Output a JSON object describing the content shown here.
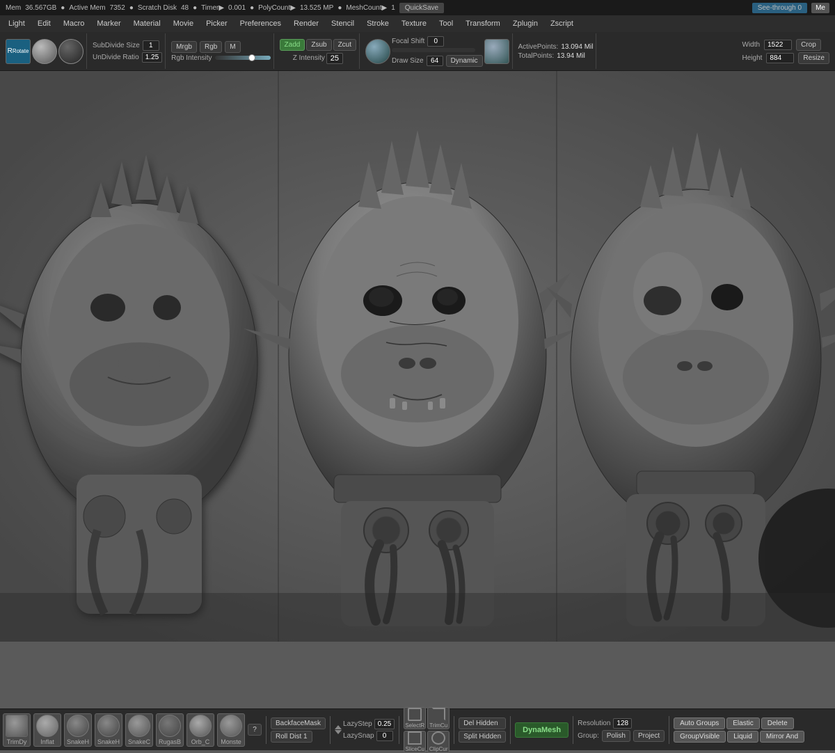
{
  "statusBar": {
    "memory": "36.567GB",
    "activeMem": "7352",
    "scratchDisk": "48",
    "timer": "0.001",
    "polyCount": "13.525 MP",
    "meshCount": "1",
    "quickSave": "QuickSave",
    "seeThrough": "See-through",
    "seeThroughVal": "0",
    "meBtn": "Me"
  },
  "menuBar": {
    "items": [
      "Light",
      "Edit",
      "Macro",
      "Marker",
      "Material",
      "Movie",
      "Picker",
      "Preferences",
      "Render",
      "Stencil",
      "Stroke",
      "Texture",
      "Tool",
      "Transform",
      "Zplugin",
      "Zscript"
    ]
  },
  "toolbar": {
    "subdivSize": "1",
    "undivideRatio": "1.25",
    "mrgb": "Mrgb",
    "rgb": "Rgb",
    "m": "M",
    "zadd": "Zadd",
    "zsub": "Zsub",
    "zcut": "Zcut",
    "zIntensity": "25",
    "focalShift": "0",
    "drawSize": "64",
    "dynamic": "Dynamic",
    "activePoints": "13.094 Mil",
    "totalPoints": "13.94 Mil",
    "width": "1522",
    "height": "884",
    "crop": "Crop",
    "resize": "Resize",
    "rgbIntensity": "Rgb Intensity"
  },
  "bottomToolbar": {
    "brushes": [
      {
        "label": "TrimDy"
      },
      {
        "label": "Inflat"
      },
      {
        "label": "SnakeH"
      },
      {
        "label": "SnakeH"
      },
      {
        "label": "SnakeC"
      },
      {
        "label": "RugasB"
      },
      {
        "label": "Orb_C"
      },
      {
        "label": "Monste"
      }
    ],
    "question": "?",
    "backfaceMask": "BackfaceMask",
    "rollDist": "Roll Dist 1",
    "lazyStep": "0.25",
    "lazySnap": "0",
    "lazyStepLabel": "LazyStep",
    "lazySnapLabel": "LazySnap",
    "selectR": "SelectR",
    "trimCu": "TrimCu",
    "sliceCu": "SliceCu",
    "clipCur": "ClipCur",
    "delHidden": "Del Hidden",
    "splitHidden": "Split Hidden",
    "dynaMesh": "DynaMesh",
    "resolution": "128",
    "resolutionLabel": "Resolution",
    "groupLabel": "Group:",
    "polish": "Polish",
    "project": "Project",
    "autoGroups": "Auto Groups",
    "elastic": "Elastic",
    "delete": "Delete",
    "groupVisible": "GroupVisible",
    "liquid": "Liquid",
    "mirrorAnd": "Mirror And"
  }
}
